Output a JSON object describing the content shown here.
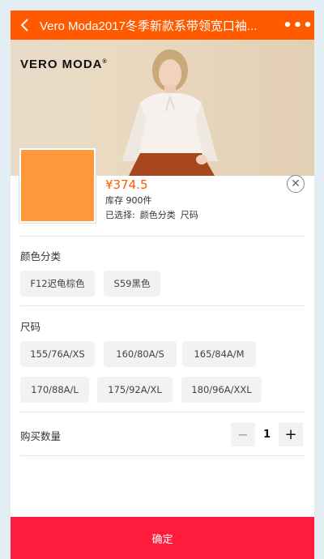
{
  "header": {
    "title": "Vero Moda2017冬季新款系带领宽口袖...",
    "back_icon": "chevron-left-icon",
    "more_icon": "more-dots-icon",
    "more_glyph": "•••",
    "bg_color": "#ff5a00"
  },
  "hero": {
    "brand_text": "VERO MODA",
    "brand_mark": "®"
  },
  "product": {
    "price": "¥374.5",
    "stock": "库存 900件",
    "selected_prefix": "已选择:",
    "selected_items": [
      "颜色分类",
      "尺码"
    ],
    "thumb_color": "#ff983b"
  },
  "close": {
    "glyph": "✕"
  },
  "sections": {
    "color": {
      "title": "颜色分类",
      "options": [
        "F12迟龟棕色",
        "S59黑色"
      ]
    },
    "size": {
      "title": "尺码",
      "options": [
        "155/76A/XS",
        "160/80A/S",
        "165/84A/M",
        "170/88A/L",
        "175/92A/XL",
        "180/96A/XXL"
      ]
    }
  },
  "quantity": {
    "label": "购买数量",
    "minus": "−",
    "value": "1",
    "plus": "+"
  },
  "confirm": {
    "label": "确定",
    "color": "#ff1b3c"
  }
}
